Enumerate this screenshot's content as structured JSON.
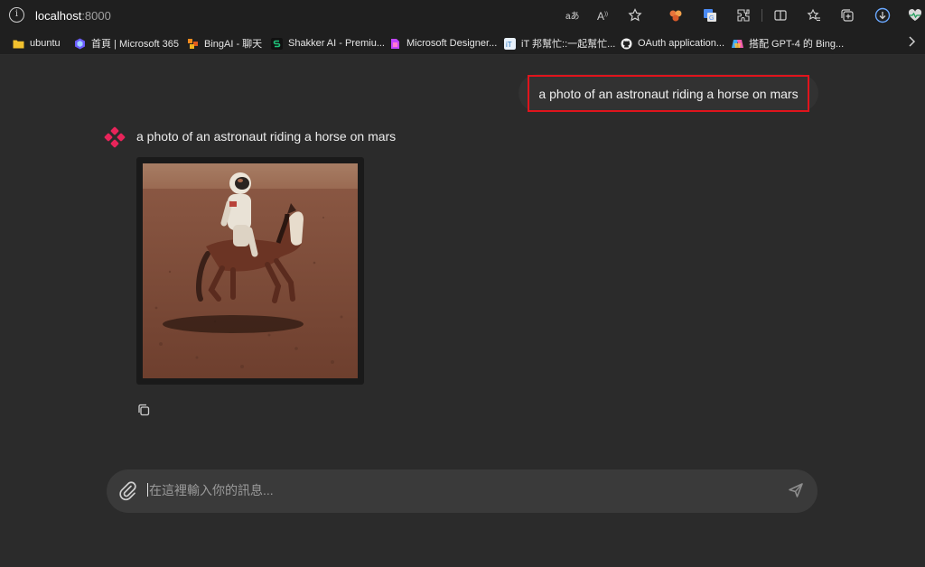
{
  "browser": {
    "url_host": "localhost",
    "url_port": ":8000",
    "toolbar_icons": [
      "read-aloud-icon",
      "text-size-icon",
      "favorite-star-icon",
      "copilot-extension-icon",
      "translate-icon",
      "extensions-icon",
      "split-screen-icon",
      "favorites-icon",
      "collections-icon",
      "downloads-icon",
      "heart-health-icon"
    ]
  },
  "bookmarks": [
    {
      "label": "ubuntu",
      "color": "#f2c12e"
    },
    {
      "label": "首頁 | Microsoft 365",
      "color": "#6b5cff"
    },
    {
      "label": "BingAI - 聊天",
      "color": "#f28a1e"
    },
    {
      "label": "Shakker AI - Premiu...",
      "color": "#1fc27a"
    },
    {
      "label": "Microsoft Designer...",
      "color": "#c245ff"
    },
    {
      "label": "iT 邦幫忙::一起幫忙...",
      "color": "#4aa3e8"
    },
    {
      "label": "OAuth application...",
      "color": "#ffffff"
    },
    {
      "label": "搭配 GPT-4 的 Bing...",
      "color": "#3fa9f5"
    }
  ],
  "chat": {
    "user_message": "a photo of an astronaut riding a horse on mars",
    "bot_message": "a photo of an astronaut riding a horse on mars",
    "image_alt": "astronaut riding a horse on mars"
  },
  "composer": {
    "placeholder": "在這裡輸入你的訊息..."
  }
}
